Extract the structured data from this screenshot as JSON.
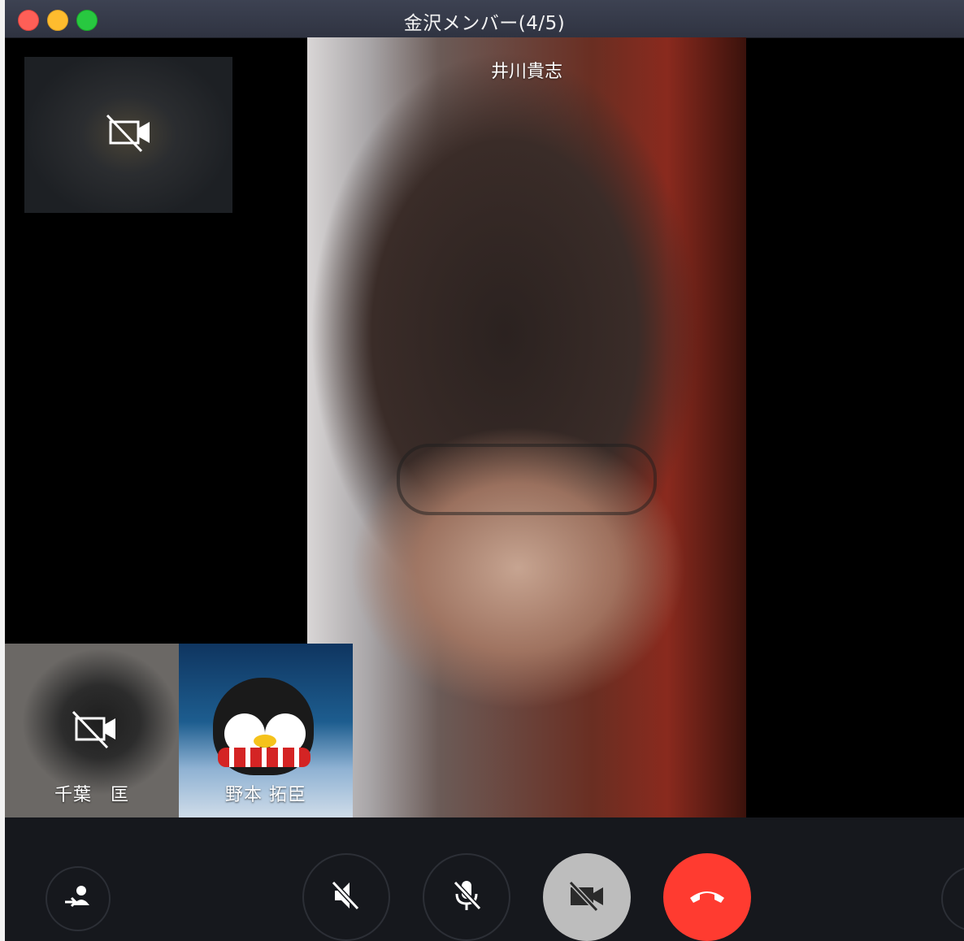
{
  "window": {
    "title": "金沢メンバー(4/5)"
  },
  "main_video": {
    "participant_name": "井川貴志"
  },
  "self_preview": {
    "camera_icon": "camera-off-icon"
  },
  "participants": [
    {
      "name": "千葉　匡",
      "camera_icon": "camera-off-icon"
    },
    {
      "name": "野本 拓臣",
      "avatar": "penguin-avatar"
    }
  ],
  "controls": {
    "invite_icon": "add-member-icon",
    "speaker_icon": "speaker-muted-icon",
    "mic_icon": "mic-muted-icon",
    "video_icon": "video-off-icon",
    "end_icon": "hang-up-icon"
  },
  "colors": {
    "end_call": "#ff3b30",
    "video_toggle_bg": "#bdbdbd",
    "control_bar": "#16181d",
    "titlebar": "#2f3341"
  }
}
